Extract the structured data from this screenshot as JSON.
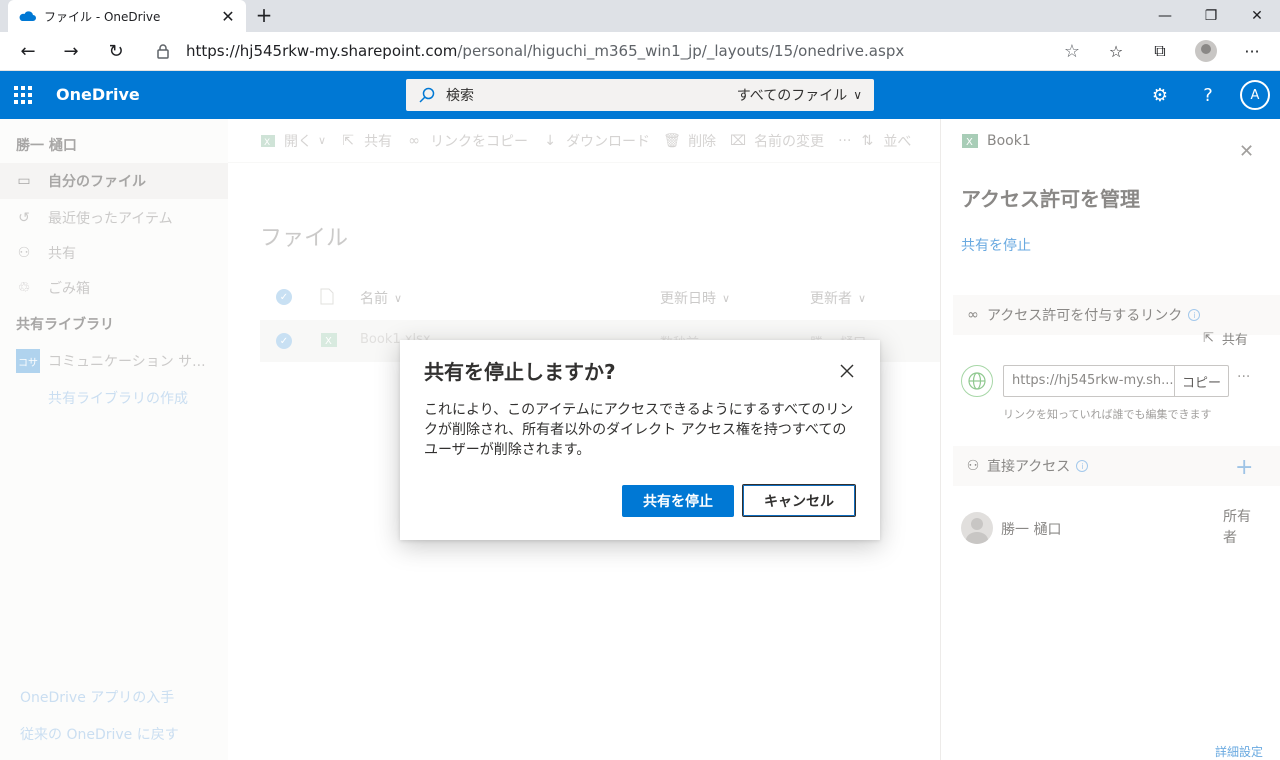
{
  "browser": {
    "tab_title": "ファイル - OneDrive",
    "url_host": "https://hj545rkw-my.sharepoint.com",
    "url_path": "/personal/higuchi_m365_win1_jp/_layouts/15/onedrive.aspx",
    "new_tab": "+"
  },
  "suite": {
    "brand": "OneDrive",
    "search_placeholder": "検索",
    "search_scope": "すべてのファイル",
    "me_glyph": "A"
  },
  "nav": {
    "user": "勝一 樋口",
    "items": [
      {
        "label": "自分のファイル",
        "icon": "folder-icon"
      },
      {
        "label": "最近使ったアイテム",
        "icon": "history-icon"
      },
      {
        "label": "共有",
        "icon": "people-icon"
      },
      {
        "label": "ごみ箱",
        "icon": "recycle-bin-icon"
      }
    ],
    "shared_libs_heading": "共有ライブラリ",
    "lib_badge": "コサ",
    "lib_name": "コミュニケーション サ...",
    "create_lib": "共有ライブラリの作成",
    "get_app": "OneDrive アプリの入手",
    "classic": "従来の OneDrive に戻す"
  },
  "commands": {
    "open": "開く",
    "share": "共有",
    "copy_link": "リンクをコピー",
    "download": "ダウンロード",
    "delete": "削除",
    "rename": "名前の変更",
    "sort": "並べ"
  },
  "files": {
    "title": "ファイル",
    "col_name": "名前",
    "col_modified": "更新日時",
    "col_modified_by": "更新者",
    "row": {
      "name": "Book1.xlsx",
      "modified": "数秒前",
      "modified_by": "勝一 樋口"
    }
  },
  "pane": {
    "file_name": "Book1",
    "heading": "アクセス許可を管理",
    "stop_sharing": "共有を停止",
    "links_section": "アクセス許可を付与するリンク",
    "share": "共有",
    "link_url": "https://hj545rkw-my.sh...",
    "copy": "コピー",
    "more": "···",
    "link_desc": "リンクを知っていれば誰でも編集できます",
    "direct_section": "直接アクセス",
    "person_name": "勝一 樋口",
    "role": "所有者",
    "advanced": "詳細設定"
  },
  "dialog": {
    "title": "共有を停止しますか?",
    "body": "これにより、このアイテムにアクセスできるようにするすべてのリンクが削除され、所有者以外のダイレクト アクセス権を持つすべてのユーザーが削除されます。",
    "confirm": "共有を停止",
    "cancel": "キャンセル"
  },
  "colors": {
    "brand_blue": "#0078d4",
    "excel_green": "#217346"
  }
}
